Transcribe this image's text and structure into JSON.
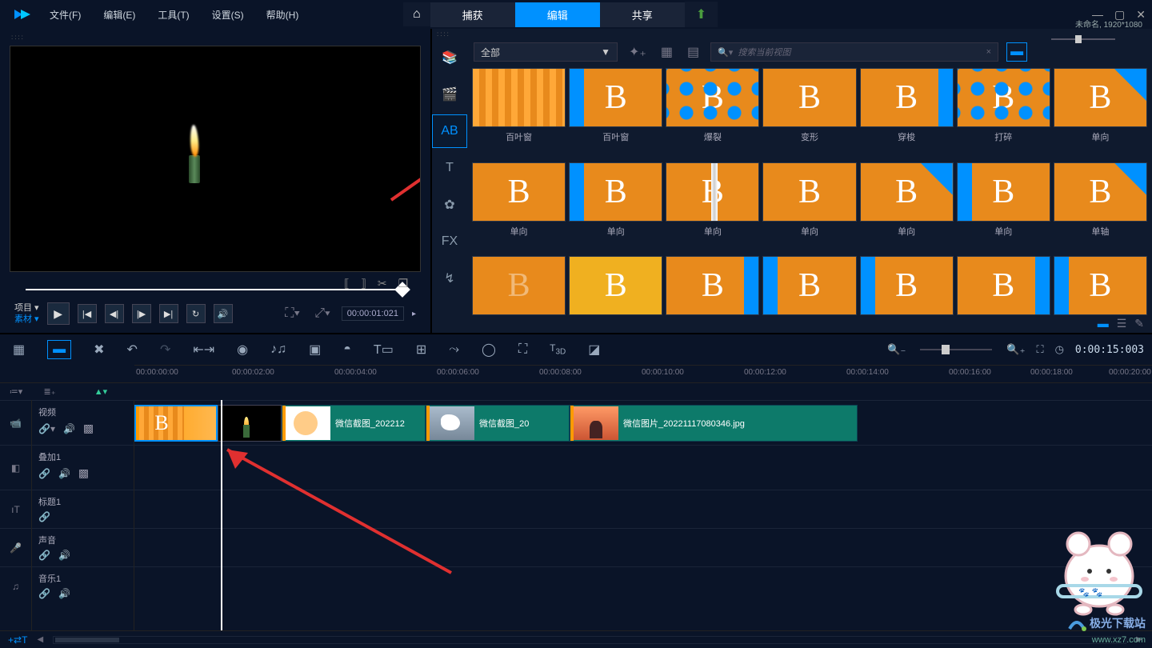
{
  "status": {
    "project": "未命名, 1920*1080"
  },
  "menu": {
    "file": "文件(F)",
    "edit": "编辑(E)",
    "tool": "工具(T)",
    "settings": "设置(S)",
    "help": "帮助(H)"
  },
  "modes": {
    "capture": "捕获",
    "edit": "编辑",
    "share": "共享"
  },
  "preview": {
    "project_label": "项目 ▾",
    "material_label": "素材 ▾",
    "timecode": "00:00:01:021",
    "tc_suffix": "▸"
  },
  "library": {
    "dropdown": "全部",
    "search_placeholder": "搜索当前视图",
    "sidebar": {
      "media": "⊞",
      "edit": "🎞",
      "transition": "AB",
      "title": "T",
      "effects": "⚙",
      "fx": "FX",
      "path": "↯"
    },
    "items_r1": [
      "百叶窗",
      "百叶窗",
      "爆裂",
      "变形",
      "穿梭",
      "打碎",
      "单向"
    ],
    "items_r2": [
      "单向",
      "单向",
      "单向",
      "单向",
      "单向",
      "单向",
      "单轴"
    ],
    "items_r3": [
      "",
      "",
      "",
      "",
      "",
      "",
      ""
    ]
  },
  "timeline": {
    "duration_display": "0:00:15:003",
    "ruler": [
      "00:00:00:00",
      "00:00:02:00",
      "00:00:04:00",
      "00:00:06:00",
      "00:00:08:00",
      "00:00:10:00",
      "00:00:12:00",
      "00:00:14:00",
      "00:00:16:00",
      "00:00:18:00",
      "00:00:20:00"
    ],
    "tracks": {
      "video": "视频",
      "overlay": "叠加1",
      "title": "标题1",
      "voice": "声音",
      "music": "音乐1"
    },
    "clips": {
      "c2": "微信截图_202212",
      "c3": "微信截图_20",
      "c4": "微信图片_20221117080346.jpg"
    }
  },
  "watermark": {
    "title": "极光下载站",
    "url": "www.xz7.com"
  }
}
